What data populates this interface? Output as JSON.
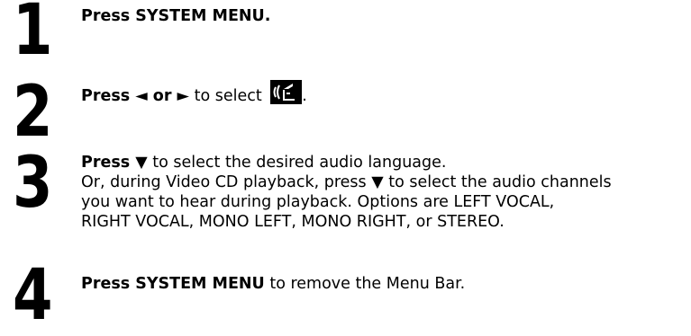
{
  "steps": [
    {
      "number": "1",
      "bold": "Press SYSTEM MENU.",
      "rest": ""
    },
    {
      "number": "2",
      "bold": "Press ◄ or ►",
      "rest": " to select ",
      "icon_name": "audio-language-icon",
      "end": "."
    },
    {
      "number": "3",
      "bold": "Press ▼",
      "rest": " to select the desired audio language.",
      "extra_lines": [
        "Or, during Video CD playback, press ▼ to select the audio channels",
        "you want to hear during playback. Options are LEFT VOCAL,",
        "RIGHT VOCAL, MONO LEFT, MONO RIGHT, or STEREO."
      ]
    },
    {
      "number": "4",
      "bold": "Press SYSTEM MENU",
      "rest": " to remove the Menu Bar."
    }
  ]
}
